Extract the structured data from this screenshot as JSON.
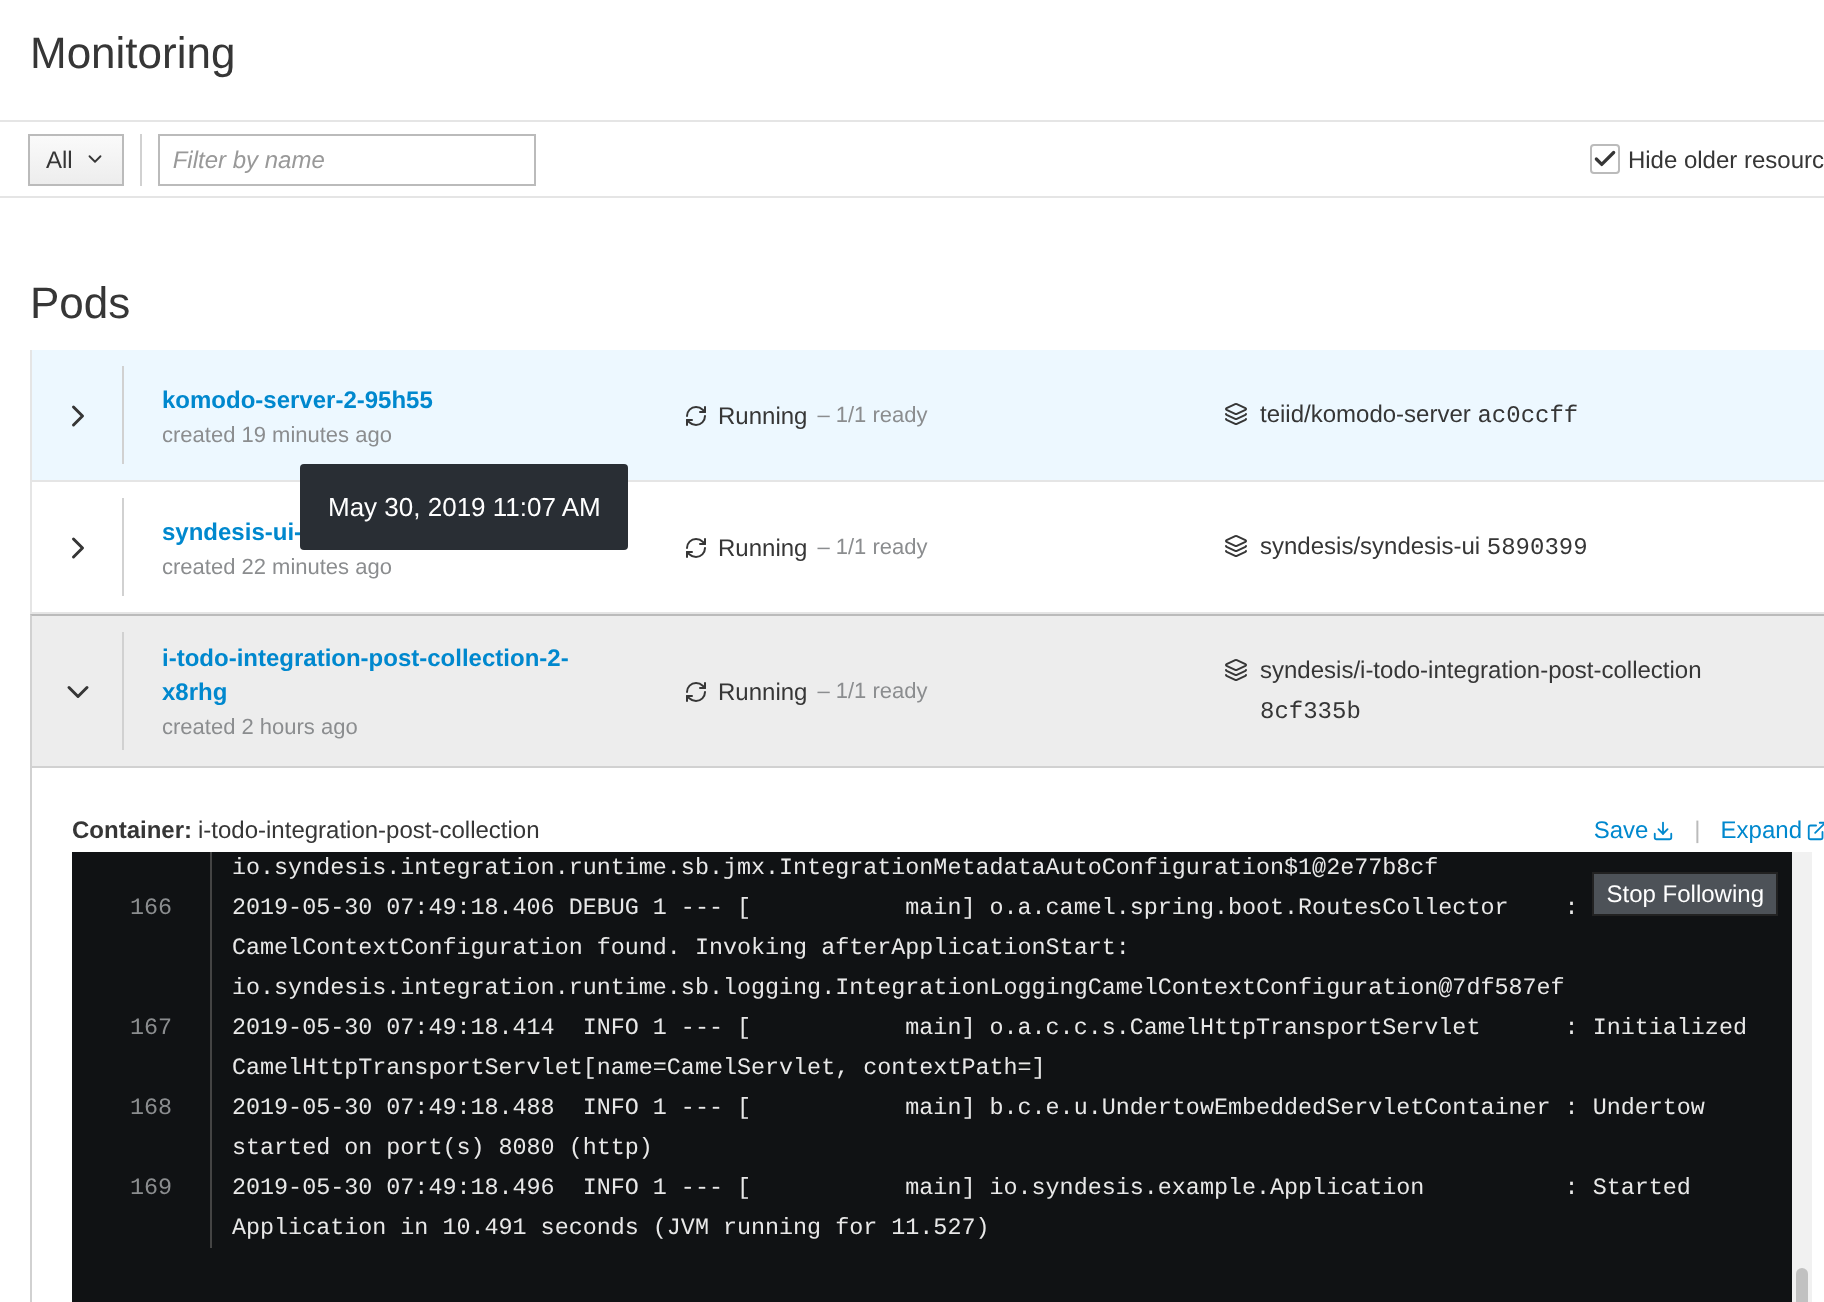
{
  "page": {
    "title": "Monitoring"
  },
  "toolbar": {
    "kind_select": "All",
    "filter": {
      "placeholder": "Filter by name"
    },
    "hide_older": {
      "label": "Hide older resourc",
      "checked": true
    }
  },
  "section_title": "Pods",
  "pods": [
    {
      "name": "komodo-server-2-95h55",
      "created": "created 19 minutes ago",
      "status": "Running",
      "ready": "– 1/1 ready",
      "image": "teiid/komodo-server",
      "tag": "ac0ccff",
      "highlighted": true,
      "expanded": false
    },
    {
      "name": "syndesis-ui-",
      "created": "created 22 minutes ago",
      "status": "Running",
      "ready": "– 1/1 ready",
      "image": "syndesis/syndesis-ui",
      "tag": "5890399",
      "highlighted": false,
      "expanded": false
    },
    {
      "name": "i-todo-integration-post-collection-2-x8rhg",
      "created": "created 2 hours ago",
      "status": "Running",
      "ready": "– 1/1 ready",
      "image": "syndesis/i-todo-integration-post-collection",
      "tag": "8cf335b",
      "highlighted": false,
      "expanded": true
    }
  ],
  "tooltip": "May 30, 2019 11:07 AM",
  "container": {
    "label": "Container:",
    "name": "i-todo-integration-post-collection",
    "save": "Save",
    "separator": "|",
    "expand": "Expand",
    "stop_following": "Stop Following"
  },
  "log": [
    {
      "lines": [
        "io.syndesis.integration.runtime.sb.jmx.IntegrationMetadataAutoConfiguration$1@2e77b8cf"
      ]
    },
    {
      "number": "166",
      "lines": [
        "2019-05-30 07:49:18.406 DEBUG 1 --- [           main] o.a.camel.spring.boot.RoutesCollector    :",
        "CamelContextConfiguration found. Invoking afterApplicationStart:",
        "io.syndesis.integration.runtime.sb.logging.IntegrationLoggingCamelContextConfiguration@7df587ef"
      ]
    },
    {
      "number": "167",
      "lines": [
        "2019-05-30 07:49:18.414  INFO 1 --- [           main] o.a.c.c.s.CamelHttpTransportServlet      : Initialized",
        "CamelHttpTransportServlet[name=CamelServlet, contextPath=]"
      ]
    },
    {
      "number": "168",
      "lines": [
        "2019-05-30 07:49:18.488  INFO 1 --- [           main] b.c.e.u.UndertowEmbeddedServletContainer : Undertow",
        "started on port(s) 8080 (http)"
      ]
    },
    {
      "number": "169",
      "lines": [
        "2019-05-30 07:49:18.496  INFO 1 --- [           main] io.syndesis.example.Application          : Started",
        "Application in 10.491 seconds (JVM running for 11.527)"
      ]
    }
  ]
}
